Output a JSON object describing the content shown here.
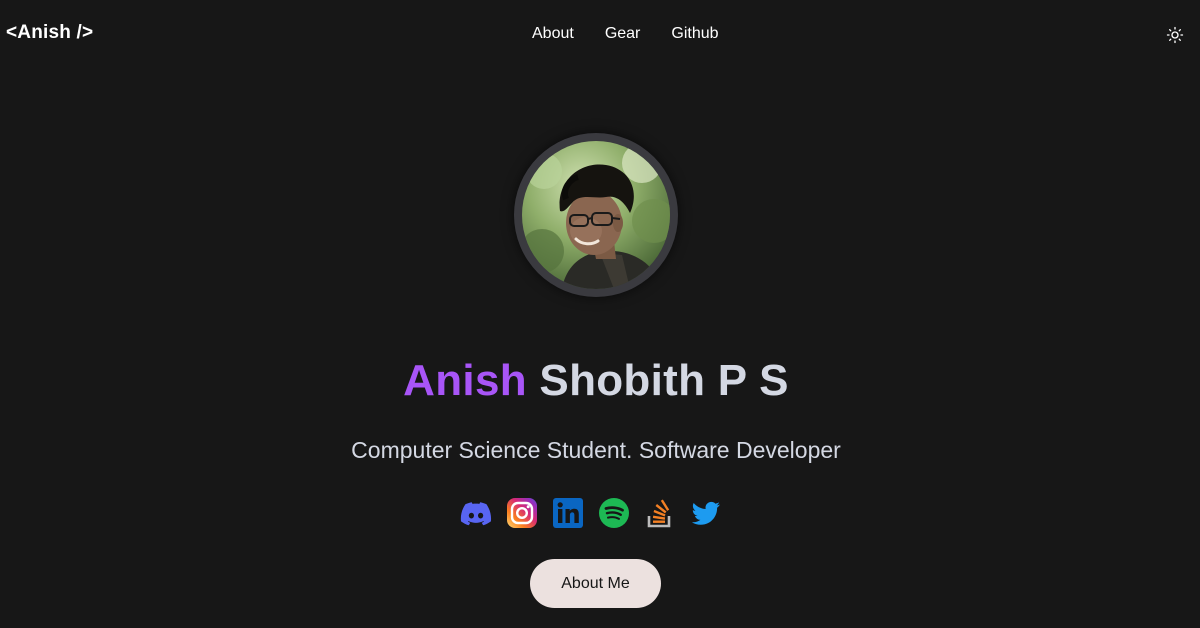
{
  "nav": {
    "logo": "<Anish />",
    "links": [
      {
        "label": "About"
      },
      {
        "label": "Gear"
      },
      {
        "label": "Github"
      }
    ],
    "theme_toggle_icon": "sun-icon"
  },
  "hero": {
    "avatar_icon": "profile-photo",
    "name_first": "Anish",
    "name_rest": " Shobith P S",
    "tagline": "Computer Science Student. Software Developer",
    "socials": [
      {
        "icon": "discord-icon",
        "color": "#5865f2"
      },
      {
        "icon": "instagram-icon",
        "color": "#e1306c"
      },
      {
        "icon": "linkedin-icon",
        "color": "#0a66c2"
      },
      {
        "icon": "spotify-icon",
        "color": "#1db954"
      },
      {
        "icon": "stackoverflow-icon",
        "color": "#f48024"
      },
      {
        "icon": "twitter-icon",
        "color": "#1d9bf0"
      }
    ],
    "cta_label": "About Me"
  },
  "colors": {
    "background": "#171717",
    "accent": "#a855f7",
    "text_muted": "#d4d8e3",
    "button_bg": "#ece1df"
  }
}
